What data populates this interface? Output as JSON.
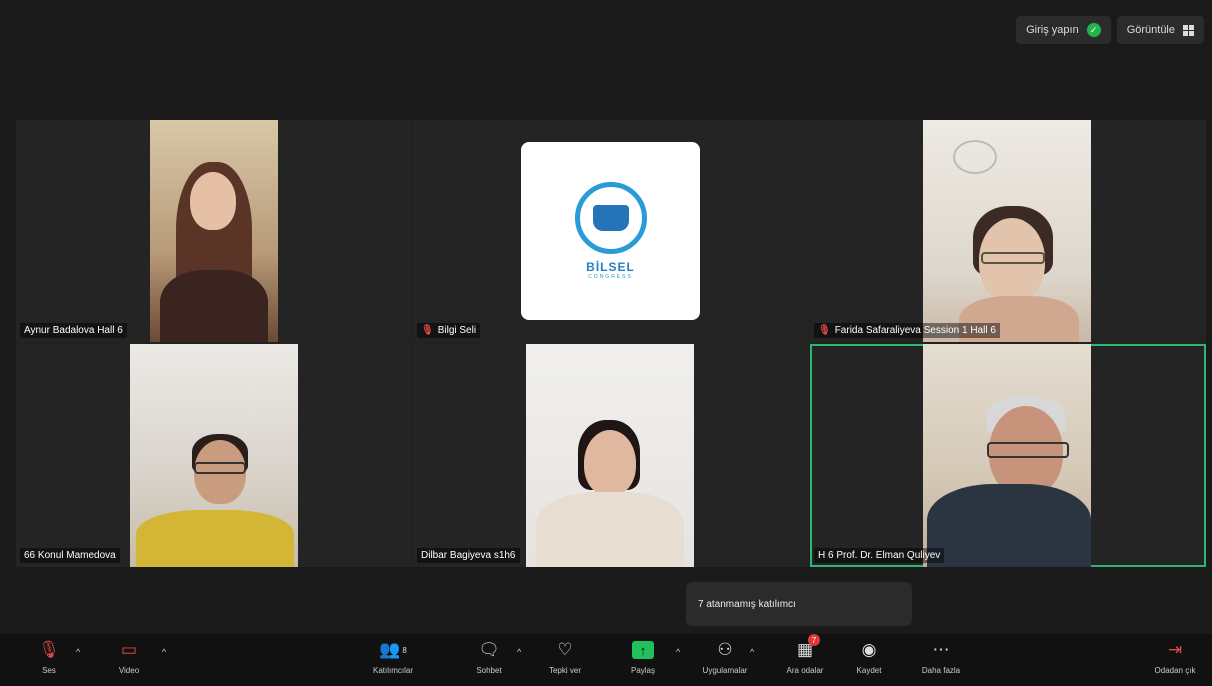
{
  "header": {
    "signin_label": "Giriş yapın",
    "view_label": "Görüntüle"
  },
  "participants": [
    {
      "name": "Aynur Badalova Hall 6"
    },
    {
      "name": "Bilgi Seli"
    },
    {
      "name": "Farida Safaraliyeva Session 1 Hall 6"
    },
    {
      "name": "66 Konul Mamedova"
    },
    {
      "name": "Dilbar Bagiyeva s1h6"
    },
    {
      "name": "H 6 Prof. Dr. Elman Quliyev"
    }
  ],
  "logo": {
    "text": "BİLSEL",
    "subtext": "CONGRESS"
  },
  "tooltip": "7 atanmamış katılımcı",
  "toolbar": {
    "audio": "Ses",
    "video": "Video",
    "participants": "Katılımcılar",
    "participants_count": "8",
    "chat": "Sohbet",
    "react": "Tepki ver",
    "share": "Paylaş",
    "apps": "Uygulamalar",
    "breakout": "Ara odalar",
    "breakout_badge": "7",
    "record": "Kaydet",
    "more": "Daha fazla",
    "leave": "Odadan çık"
  },
  "colors": {
    "accent_green": "#2fb673",
    "share_green": "#20c05c",
    "mute_red": "#e04747"
  },
  "icons": [
    "microphone-muted-icon",
    "video-off-icon",
    "participants-icon",
    "chat-icon",
    "heart-icon",
    "share-screen-icon",
    "apps-icon",
    "breakout-rooms-icon",
    "record-icon",
    "more-icon",
    "leave-icon",
    "shield-check-icon",
    "grid-view-icon"
  ]
}
